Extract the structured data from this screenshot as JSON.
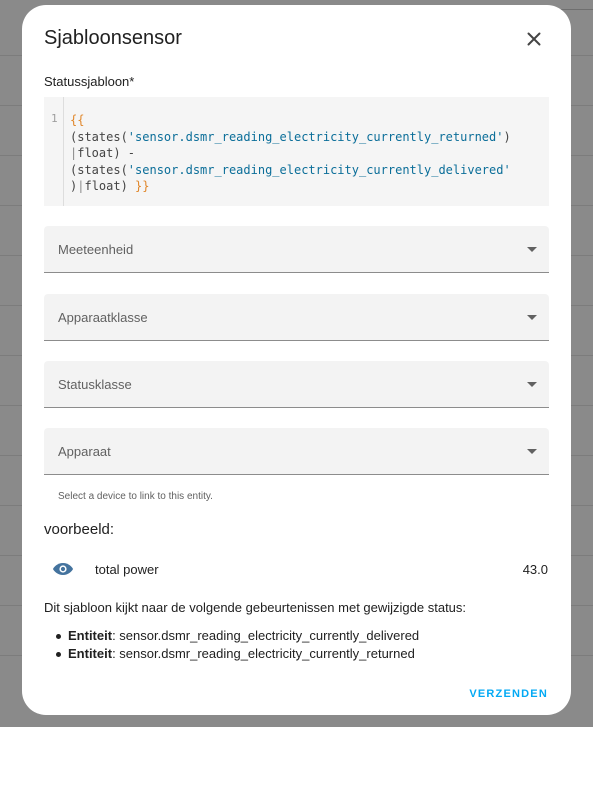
{
  "dialog": {
    "title": "Sjabloonsensor",
    "close_icon": "close-icon"
  },
  "state_template": {
    "label": "Statussjabloon*",
    "line_number": "1",
    "code_lines": [
      "{{",
      "(states('sensor.dsmr_reading_electricity_currently_returned')",
      "|float) -",
      "(states('sensor.dsmr_reading_electricity_currently_delivered'",
      ")|float) }}"
    ]
  },
  "selects": {
    "unit": {
      "label": "Meeteenheid",
      "value": ""
    },
    "device_class": {
      "label": "Apparaatklasse",
      "value": ""
    },
    "state_class": {
      "label": "Statusklasse",
      "value": ""
    },
    "device": {
      "label": "Apparaat",
      "value": "",
      "helper": "Select a device to link to this entity."
    }
  },
  "preview": {
    "heading": "voorbeeld:",
    "entity_icon": "eye-icon",
    "entity_name": "total power",
    "entity_state": "43.0",
    "listen_text": "Dit sjabloon kijkt naar de volgende gebeurtenissen met gewijzigde status:",
    "entity_label": "Entiteit",
    "entities": [
      "sensor.dsmr_reading_electricity_currently_delivered",
      "sensor.dsmr_reading_electricity_currently_returned"
    ]
  },
  "actions": {
    "submit_label": "VERZENDEN"
  },
  "colors": {
    "accent": "#03a9f4",
    "icon": "#44739e"
  }
}
